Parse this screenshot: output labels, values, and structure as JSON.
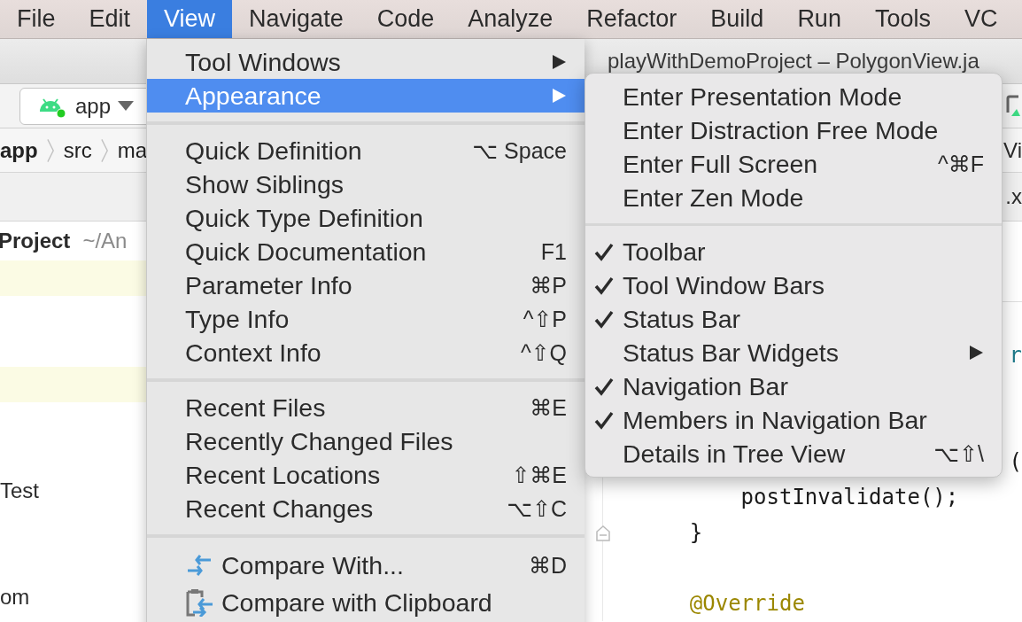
{
  "menu_bar": [
    {
      "label": "File",
      "selected": false
    },
    {
      "label": "Edit",
      "selected": false
    },
    {
      "label": "View",
      "selected": true
    },
    {
      "label": "Navigate",
      "selected": false
    },
    {
      "label": "Code",
      "selected": false
    },
    {
      "label": "Analyze",
      "selected": false
    },
    {
      "label": "Refactor",
      "selected": false
    },
    {
      "label": "Build",
      "selected": false
    },
    {
      "label": "Run",
      "selected": false
    },
    {
      "label": "Tools",
      "selected": false
    },
    {
      "label": "VC",
      "selected": false
    }
  ],
  "window_title": "playWithDemoProject – PolygonView.ja",
  "run_config": {
    "label": "app"
  },
  "breadcrumbs": [
    "app",
    "src",
    "ma"
  ],
  "nav_bar_tail": "Vi",
  "editor_tab_tail": ".x",
  "project_panel": {
    "title": "Project",
    "path": "~/An",
    "rows": [
      {
        "highlighted": true
      },
      {
        "highlighted": false
      },
      {
        "highlighted": false
      },
      {
        "highlighted": true
      },
      {
        "highlighted": false
      },
      {
        "highlighted": false
      },
      {
        "label": "Test",
        "highlighted": false
      },
      {
        "highlighted": false
      },
      {
        "highlighted": false
      },
      {
        "label": "om",
        "highlighted": false
      }
    ]
  },
  "editor_lines": [
    {
      "kind": "blank"
    },
    {
      "kind": "field-edge",
      "text": "r"
    },
    {
      "kind": "blank"
    },
    {
      "kind": "blank"
    },
    {
      "kind": "plain-edge",
      "text": "("
    },
    {
      "kind": "plain",
      "text": "        postInvalidate();"
    },
    {
      "kind": "plain",
      "text": "    }",
      "fold": true
    },
    {
      "kind": "blank"
    },
    {
      "kind": "annotation",
      "text": "    @Override"
    }
  ],
  "view_menu": [
    [
      {
        "label": "Tool Windows",
        "submenu": true,
        "selected": false
      },
      {
        "label": "Appearance",
        "submenu": true,
        "selected": true
      }
    ],
    [
      {
        "label": "Quick Definition",
        "shortcut": "⌥ Space",
        "submenu": false,
        "selected": false
      },
      {
        "label": "Show Siblings",
        "submenu": false,
        "selected": false
      },
      {
        "label": "Quick Type Definition",
        "submenu": false,
        "selected": false
      },
      {
        "label": "Quick Documentation",
        "shortcut": "F1",
        "submenu": false,
        "selected": false
      },
      {
        "label": "Parameter Info",
        "shortcut": "⌘P",
        "submenu": false,
        "selected": false
      },
      {
        "label": "Type Info",
        "shortcut": "^⇧P",
        "submenu": false,
        "selected": false
      },
      {
        "label": "Context Info",
        "shortcut": "^⇧Q",
        "submenu": false,
        "selected": false
      }
    ],
    [
      {
        "label": "Recent Files",
        "shortcut": "⌘E",
        "submenu": false,
        "selected": false
      },
      {
        "label": "Recently Changed Files",
        "submenu": false,
        "selected": false
      },
      {
        "label": "Recent Locations",
        "shortcut": "⇧⌘E",
        "submenu": false,
        "selected": false
      },
      {
        "label": "Recent Changes",
        "shortcut": "⌥⇧C",
        "submenu": false,
        "selected": false
      }
    ],
    [
      {
        "label": "Compare With...",
        "shortcut": "⌘D",
        "kind": "compare",
        "submenu": false,
        "selected": false
      },
      {
        "label": "Compare with Clipboard",
        "kind": "clipboard",
        "submenu": false,
        "selected": false
      }
    ]
  ],
  "appearance_menu": [
    [
      {
        "label": "Enter Presentation Mode",
        "checked": false,
        "submenu": false,
        "selected": false
      },
      {
        "label": "Enter Distraction Free Mode",
        "checked": false,
        "submenu": false,
        "selected": false
      },
      {
        "label": "Enter Full Screen",
        "shortcut": "^⌘F",
        "checked": false,
        "submenu": false,
        "selected": false
      },
      {
        "label": "Enter Zen Mode",
        "checked": false,
        "submenu": false,
        "selected": false
      }
    ],
    [
      {
        "label": "Toolbar",
        "checked": true,
        "submenu": false,
        "selected": false
      },
      {
        "label": "Tool Window Bars",
        "checked": true,
        "submenu": false,
        "selected": false
      },
      {
        "label": "Status Bar",
        "checked": true,
        "submenu": false,
        "selected": false
      },
      {
        "label": "Status Bar Widgets",
        "checked": false,
        "submenu": true,
        "selected": false
      },
      {
        "label": "Navigation Bar",
        "checked": true,
        "submenu": false,
        "selected": false
      },
      {
        "label": "Members in Navigation Bar",
        "checked": true,
        "submenu": false,
        "selected": false
      },
      {
        "label": "Details in Tree View",
        "shortcut": "⌥⇧\\",
        "checked": false,
        "submenu": false,
        "selected": false
      }
    ]
  ]
}
